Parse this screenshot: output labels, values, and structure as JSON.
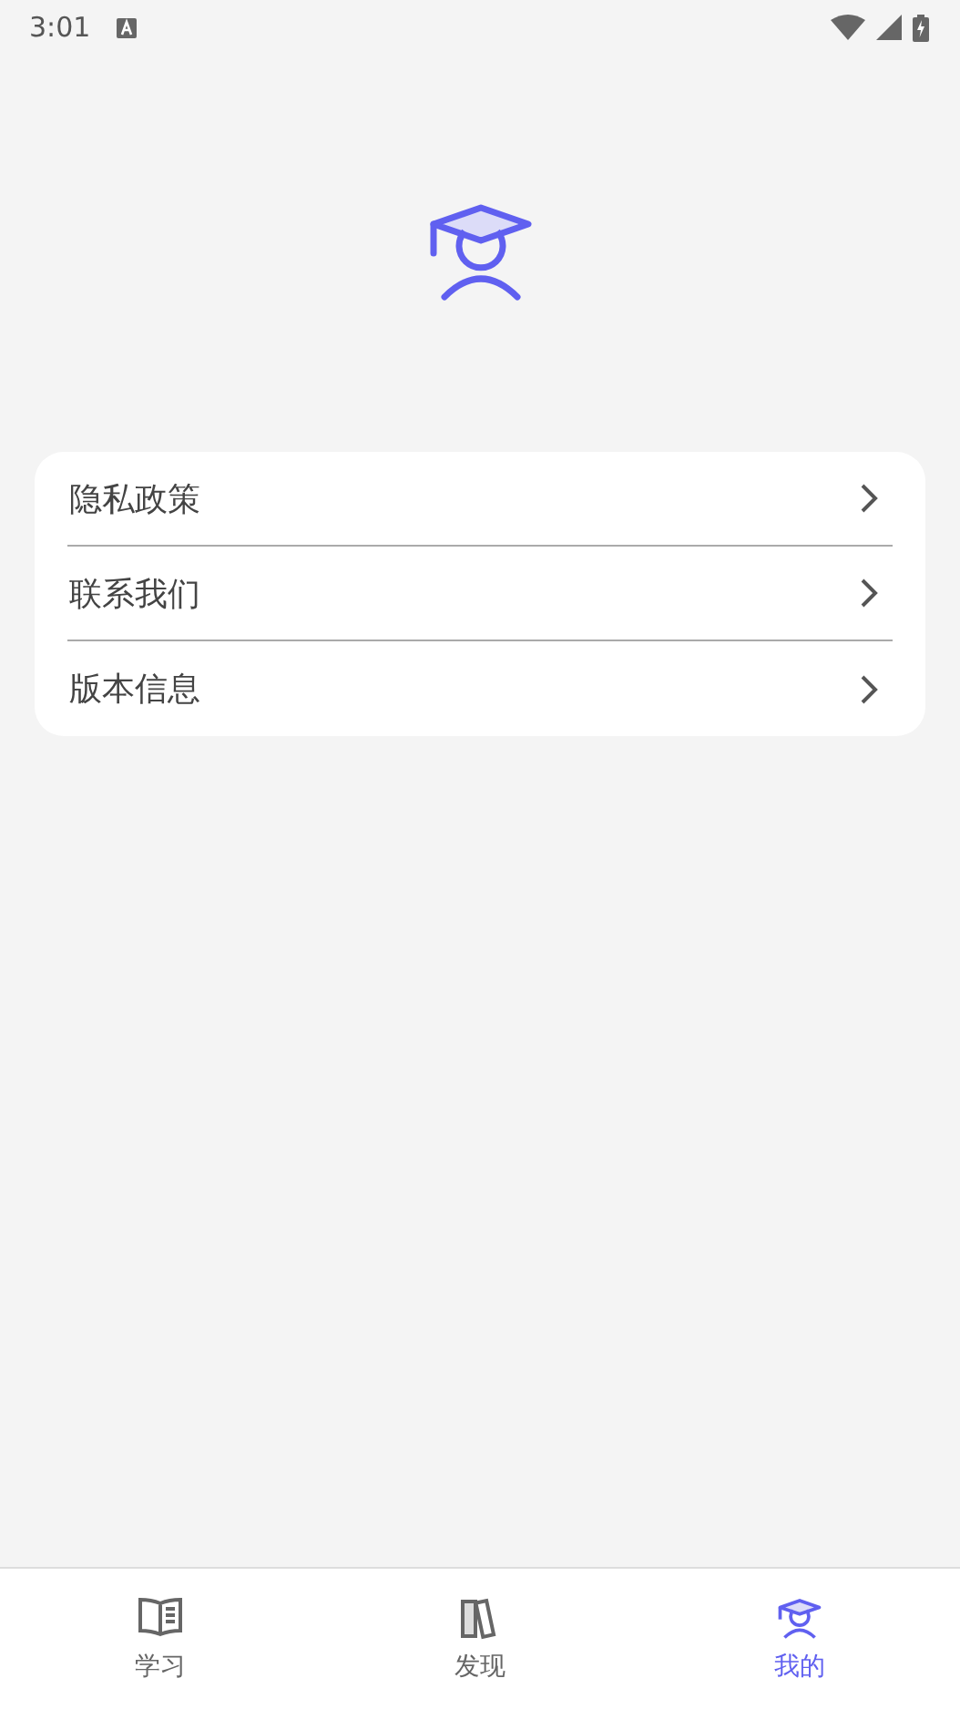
{
  "status_bar": {
    "time": "3:01"
  },
  "menu": [
    {
      "label": "隐私政策"
    },
    {
      "label": "联系我们"
    },
    {
      "label": "版本信息"
    }
  ],
  "tabs": [
    {
      "label": "学习",
      "kind": "book",
      "selected": false
    },
    {
      "label": "发现",
      "kind": "books",
      "selected": false
    },
    {
      "label": "我的",
      "kind": "student",
      "selected": true
    }
  ]
}
